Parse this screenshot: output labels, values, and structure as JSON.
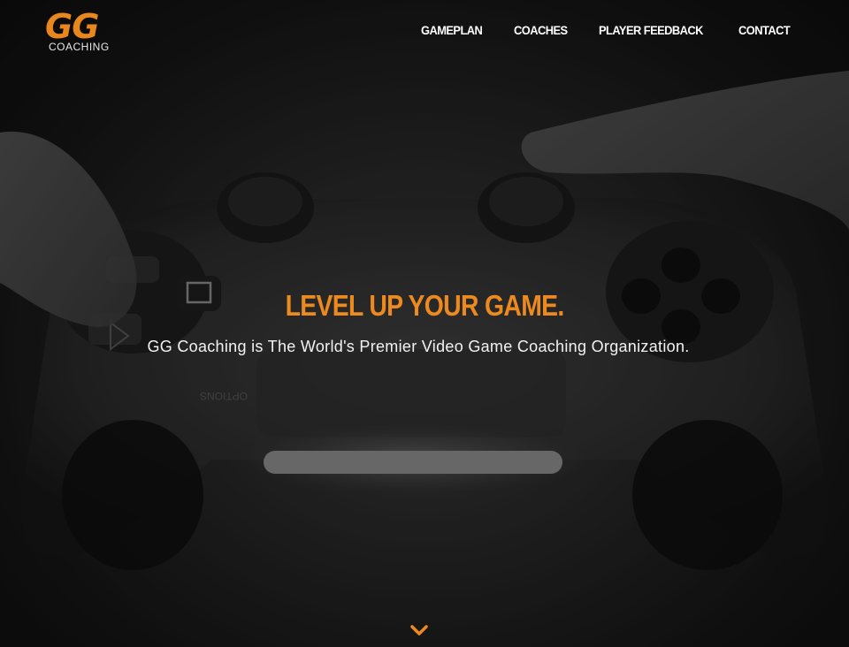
{
  "logo": {
    "mark": "GG",
    "subtitle": "COACHING"
  },
  "nav": {
    "items": [
      {
        "label": "GAMEPLAN"
      },
      {
        "label": "COACHES"
      },
      {
        "label": "PLAYER FEEDBACK"
      },
      {
        "label": "CONTACT"
      }
    ]
  },
  "hero": {
    "headline": "LEVEL UP YOUR GAME.",
    "subline": "GG Coaching is The World's Premier Video Game Coaching Organization.",
    "background_icon": "game-controller-photo",
    "scroll_icon": "chevron-down-icon"
  },
  "colors": {
    "accent": "#ec8a1f",
    "text": "#ffffff",
    "background": "#1a1a1a"
  }
}
